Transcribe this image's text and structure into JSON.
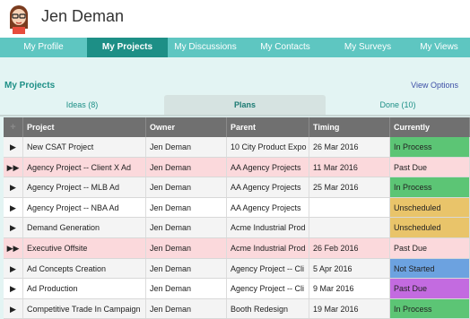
{
  "user": {
    "name": "Jen Deman"
  },
  "nav": [
    "My Profile",
    "My Projects",
    "My Discussions",
    "My Contacts",
    "My Surveys",
    "My Views"
  ],
  "section": {
    "title": "My Projects",
    "view_options": "View Options"
  },
  "tabs": [
    "Ideas (8)",
    "Plans",
    "Done (10)"
  ],
  "table": {
    "headers": [
      "+",
      "Project",
      "Owner",
      "Parent",
      "Timing",
      "Currently"
    ],
    "rows": [
      {
        "icon": "▶",
        "project": "New CSAT Project",
        "owner": "Jen Deman",
        "parent": "10 City Product Expo",
        "timing": "26 Mar 2016",
        "status": "In Process"
      },
      {
        "icon": "▶▶",
        "project": "Agency Project -- Client X Ad",
        "owner": "Jen Deman",
        "parent": "AA Agency Projects",
        "timing": "11 Mar 2016",
        "status": "Past Due"
      },
      {
        "icon": "▶",
        "project": "Agency Project -- MLB Ad",
        "owner": "Jen Deman",
        "parent": "AA Agency Projects",
        "timing": "25 Mar 2016",
        "status": "In Process"
      },
      {
        "icon": "▶",
        "project": "Agency Project -- NBA Ad",
        "owner": "Jen Deman",
        "parent": "AA Agency Projects",
        "timing": "",
        "status": "Unscheduled"
      },
      {
        "icon": "▶",
        "project": "Demand Generation",
        "owner": "Jen Deman",
        "parent": "Acme Industrial Prod",
        "timing": "",
        "status": "Unscheduled"
      },
      {
        "icon": "▶▶",
        "project": "Executive Offsite",
        "owner": "Jen Deman",
        "parent": "Acme Industrial Prod",
        "timing": "26 Feb 2016",
        "status": "Past Due"
      },
      {
        "icon": "▶",
        "project": "Ad Concepts Creation",
        "owner": "Jen Deman",
        "parent": "Agency Project -- Cli",
        "timing": "5 Apr 2016",
        "status": "Not Started"
      },
      {
        "icon": "▶",
        "project": "Ad Production",
        "owner": "Jen Deman",
        "parent": "Agency Project -- Cli",
        "timing": "9 Mar 2016",
        "status": "Past Due"
      },
      {
        "icon": "▶",
        "project": "Competitive Trade In Campaign",
        "owner": "Jen Deman",
        "parent": "Booth Redesign",
        "timing": "19 Mar 2016",
        "status": "In Process"
      }
    ]
  },
  "colors": {
    "accent": "#1d8f86",
    "nav": "#5ec6c1"
  }
}
